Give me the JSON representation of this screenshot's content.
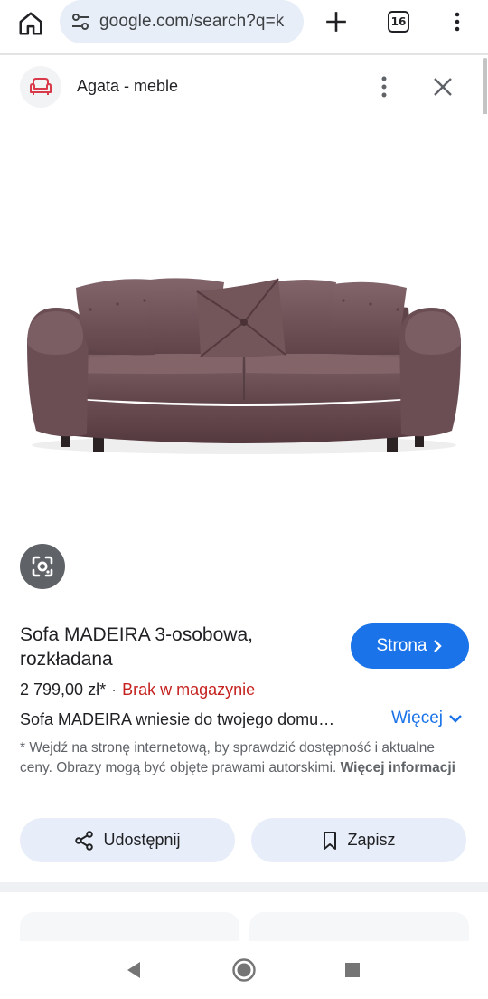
{
  "browser": {
    "url": "google.com/search?q=k",
    "tab_count": "16"
  },
  "panel": {
    "source_name": "Agata - meble"
  },
  "product": {
    "title": "Sofa MADEIRA 3-osobowa, rozkładana",
    "visit_label": "Strona",
    "price": "2 799,00 zł*",
    "separator": "·",
    "stock_status": "Brak w magazynie",
    "description": "Sofa MADEIRA wniesie do twojego domu…",
    "more_label": "Więcej",
    "note_text": "* Wejdź na stronę internetową, by sprawdzić dostępność i aktualne ceny. Obrazy mogą być objęte prawami autorskimi.",
    "note_link": "Więcej informacji"
  },
  "actions": {
    "share_label": "Udostępnij",
    "save_label": "Zapisz"
  },
  "colors": {
    "accent": "#1a73e8",
    "stock_red": "#c5221f",
    "sofa": "#6e5156"
  },
  "icons": [
    "home-icon",
    "tune-icon",
    "plus-icon",
    "tabs-icon",
    "more-vert-icon",
    "sofa-logo-icon",
    "more-vert-icon",
    "close-icon",
    "lens-icon",
    "chevron-right-icon",
    "chevron-down-icon",
    "share-icon",
    "bookmark-icon",
    "nav-back-icon",
    "nav-home-icon",
    "nav-recent-icon"
  ]
}
